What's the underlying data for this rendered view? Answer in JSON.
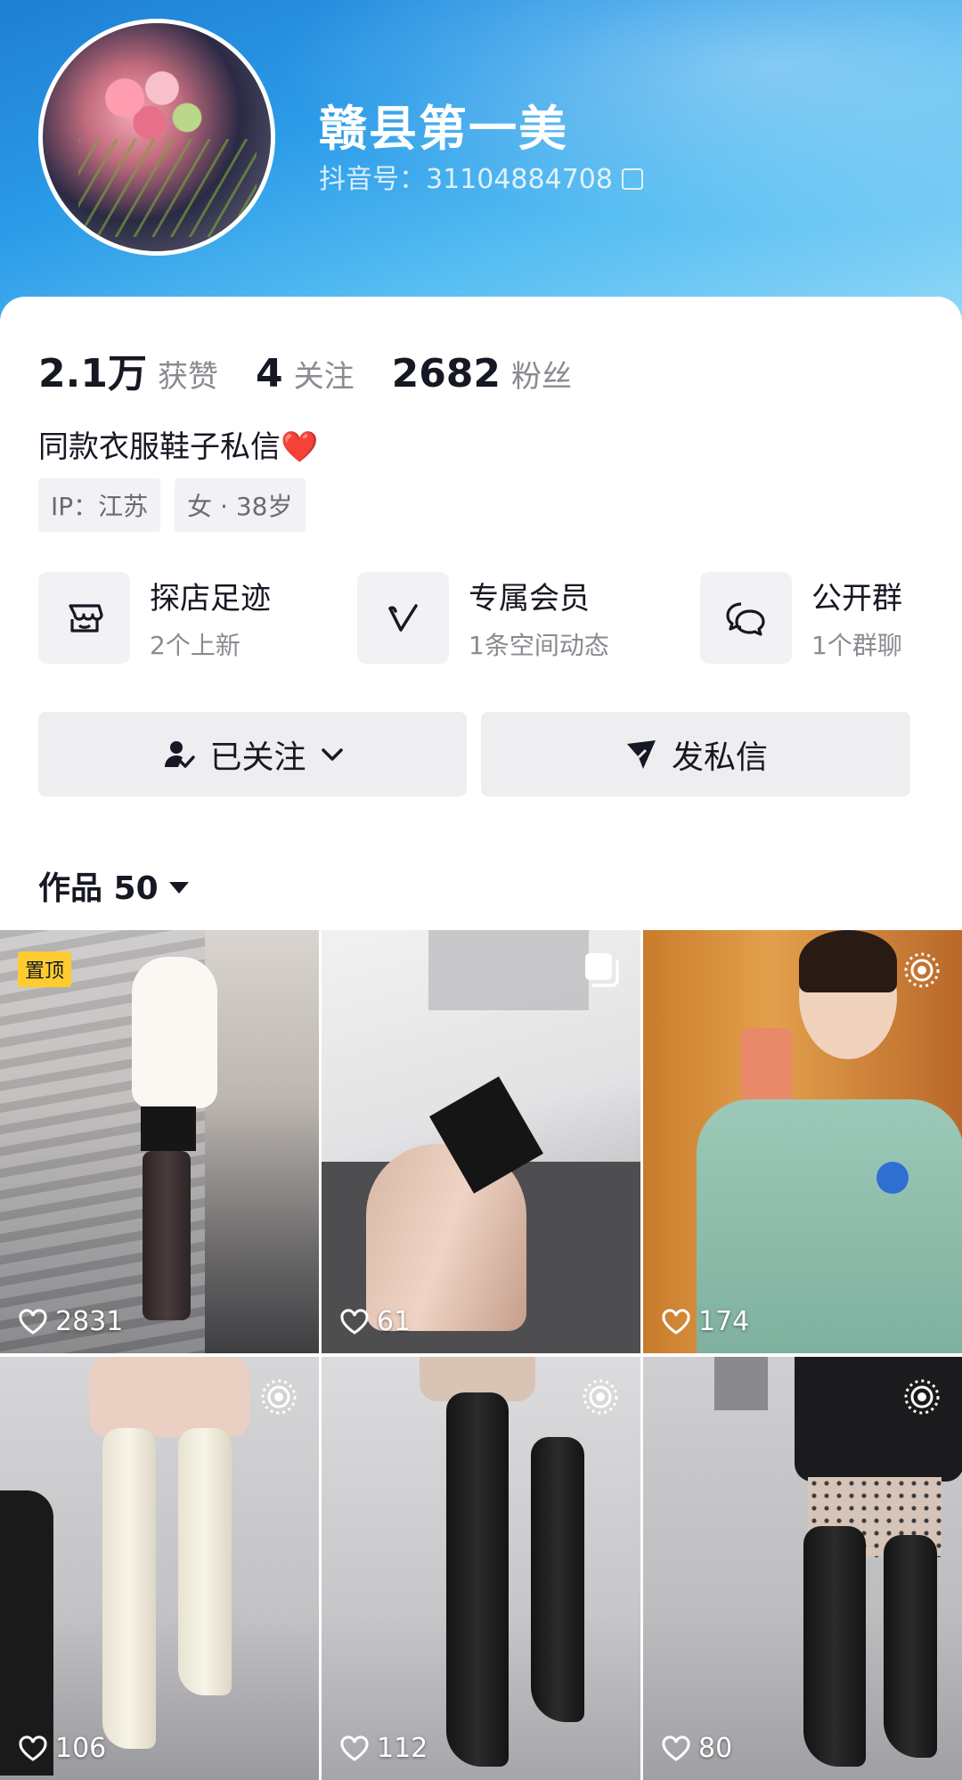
{
  "profile": {
    "nickname": "赣县第一美",
    "douyin_id": "抖音号：31104884708"
  },
  "stats": [
    {
      "num": "2.1万",
      "label": "获赞"
    },
    {
      "num": "4",
      "label": "关注"
    },
    {
      "num": "2682",
      "label": "粉丝"
    }
  ],
  "bio": {
    "text": "同款衣服鞋子私信",
    "emoji": "❤️"
  },
  "tags": [
    "IP：江苏",
    "女 · 38岁"
  ],
  "features": [
    {
      "title": "探店足迹",
      "sub": "2个上新",
      "icon": "store-icon"
    },
    {
      "title": "专属会员",
      "sub": "1条空间动态",
      "icon": "vip-icon"
    },
    {
      "title": "公开群",
      "sub": "1个群聊",
      "icon": "group-chat-icon"
    }
  ],
  "buttons": {
    "follow": "已关注",
    "message": "发私信"
  },
  "works": {
    "label": "作品 50"
  },
  "videos": [
    {
      "likes": "2831",
      "badge": "置顶",
      "corner": ""
    },
    {
      "likes": "61",
      "badge": "",
      "corner": "multi-image-icon"
    },
    {
      "likes": "174",
      "badge": "",
      "corner": "live-icon"
    },
    {
      "likes": "106",
      "badge": "",
      "corner": "live-icon"
    },
    {
      "likes": "112",
      "badge": "",
      "corner": "live-icon"
    },
    {
      "likes": "80",
      "badge": "",
      "corner": "live-icon"
    }
  ],
  "colors": {
    "accent_blue": "#2b9be8",
    "pin_yellow": "#fecc2f",
    "heart_red": "#e8222d"
  }
}
